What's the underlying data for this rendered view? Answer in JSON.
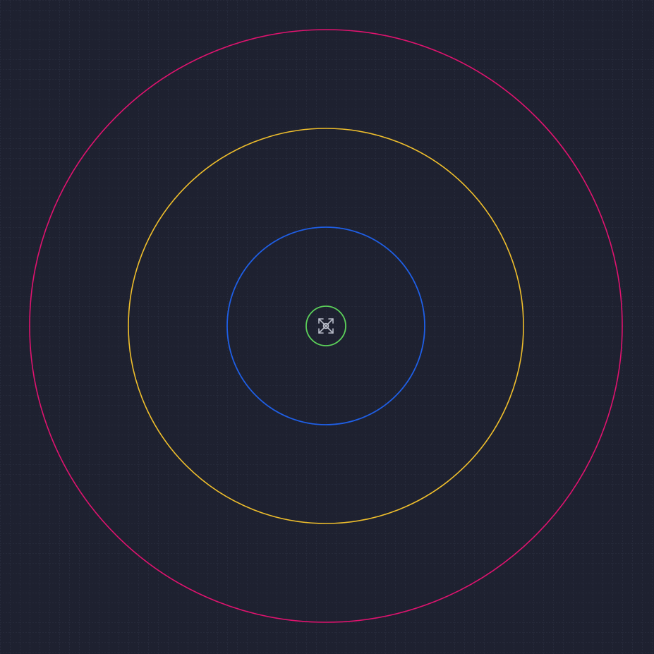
{
  "canvas": {
    "background": "#1e2130",
    "grid_color": "#3a4154",
    "grid_style": "dotted"
  },
  "rings": [
    {
      "name": "ring-outer",
      "color": "#e0136f"
    },
    {
      "name": "ring-third",
      "color": "#f0bf2c"
    },
    {
      "name": "ring-second",
      "color": "#1f5fe6"
    },
    {
      "name": "ring-inner",
      "color": "#5cd15a"
    }
  ],
  "center_marker": {
    "icon": "crossed-arrows-icon",
    "color": "#b8bcc8"
  }
}
